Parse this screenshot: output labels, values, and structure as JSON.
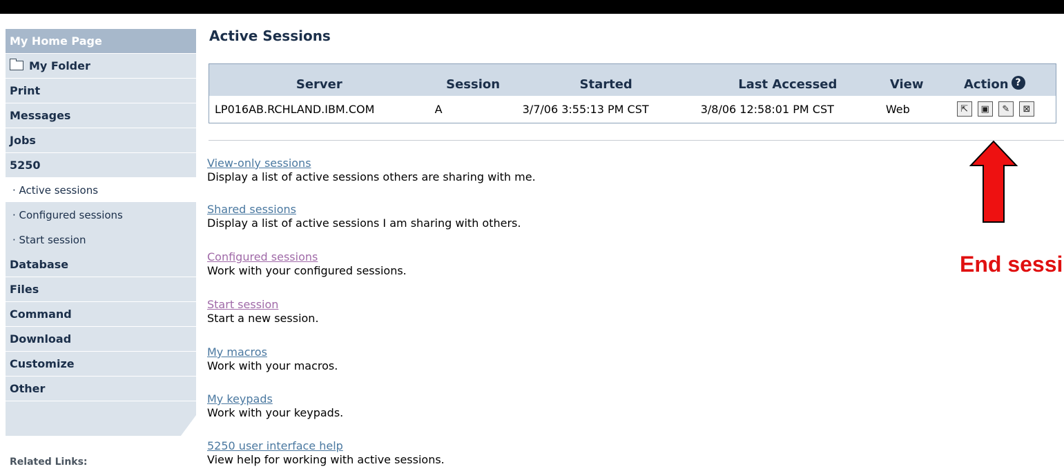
{
  "sidebar": {
    "items": [
      {
        "label": "My Home Page"
      },
      {
        "label": "My Folder"
      },
      {
        "label": "Print"
      },
      {
        "label": "Messages"
      },
      {
        "label": "Jobs"
      },
      {
        "label": "5250"
      },
      {
        "label": "· Active sessions"
      },
      {
        "label": "· Configured sessions"
      },
      {
        "label": "· Start session"
      },
      {
        "label": "Database"
      },
      {
        "label": "Files"
      },
      {
        "label": "Command"
      },
      {
        "label": "Download"
      },
      {
        "label": "Customize"
      },
      {
        "label": "Other"
      }
    ],
    "related_links": "Related Links:"
  },
  "main": {
    "title": "Active Sessions",
    "table": {
      "headers": [
        "Server",
        "Session",
        "Started",
        "Last Accessed",
        "View",
        "Action"
      ],
      "rows": [
        {
          "server": "LP016AB.RCHLAND.IBM.COM",
          "session": "A",
          "started": "3/7/06 3:55:13 PM CST",
          "last_accessed": "3/8/06 12:58:01 PM CST",
          "view": "Web"
        }
      ],
      "help_icon": "?"
    },
    "links": [
      {
        "label": "View-only sessions",
        "desc": "Display a list of active sessions others are sharing with me."
      },
      {
        "label": "Shared sessions",
        "desc": "Display a list of active sessions I am sharing with others."
      },
      {
        "label": "Configured sessions",
        "desc": "Work with your configured sessions."
      },
      {
        "label": "Start session",
        "desc": "Start a new session."
      },
      {
        "label": "My macros",
        "desc": "Work with your macros."
      },
      {
        "label": "My keypads",
        "desc": "Work with your keypads."
      },
      {
        "label": "5250 user interface help",
        "desc": "View help for working with active sessions."
      }
    ]
  },
  "annotation": {
    "label": "End sessi",
    "color": "#e01010"
  },
  "colors": {
    "nav_bg": "#dbe3eb",
    "nav_home_bg": "#a7b8cb",
    "header_bg": "#cfdae6",
    "link": "#4a78a0",
    "link_visited": "#a06aa8"
  }
}
